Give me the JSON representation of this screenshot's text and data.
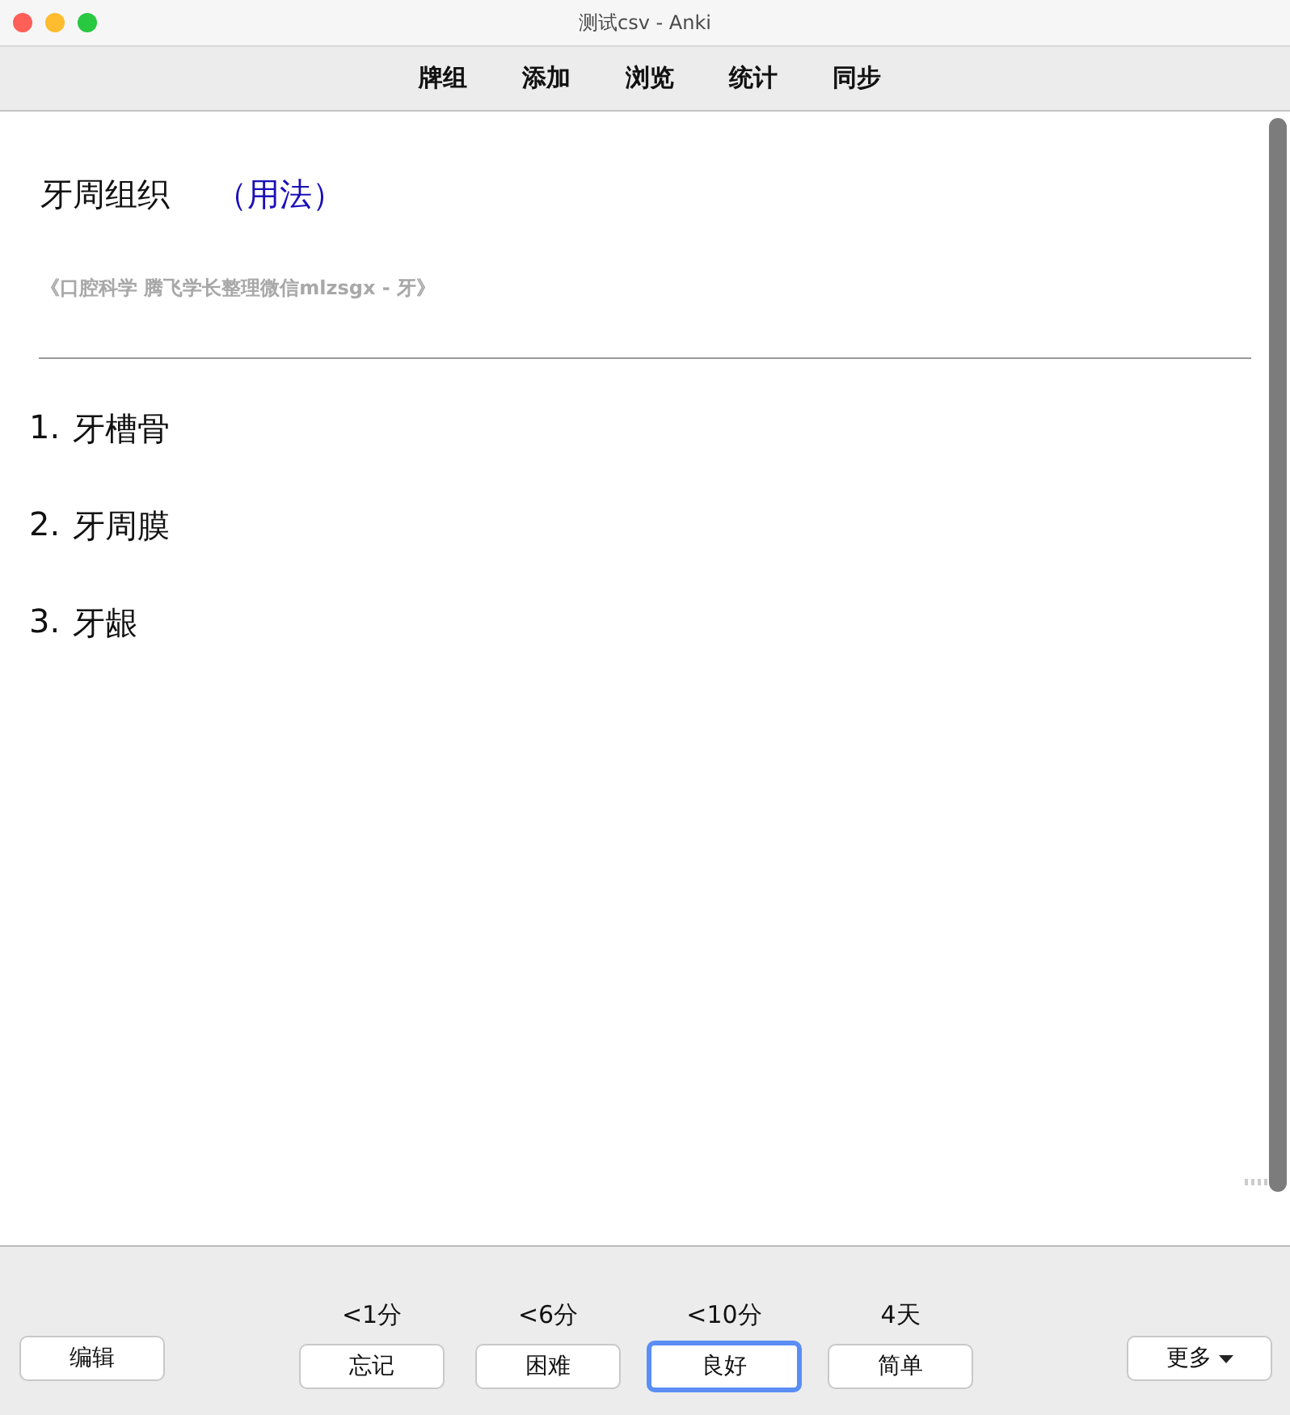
{
  "window": {
    "title": "测试csv - Anki"
  },
  "toolbar": [
    "牌组",
    "添加",
    "浏览",
    "统计",
    "同步"
  ],
  "card": {
    "question": "牙周组织",
    "hint": "（用法）",
    "source": "《口腔科学 腾飞学长整理微信mlzsgx - 牙》",
    "answers": [
      {
        "number": "1.",
        "text": "牙槽骨"
      },
      {
        "number": "2.",
        "text": "牙周膜"
      },
      {
        "number": "3.",
        "text": "牙龈"
      }
    ]
  },
  "bottom": {
    "edit": "编辑",
    "more": "更多",
    "answers": [
      {
        "interval": "<1分",
        "label": "忘记",
        "selected": false
      },
      {
        "interval": "<6分",
        "label": "困难",
        "selected": false
      },
      {
        "interval": "<10分",
        "label": "良好",
        "selected": true
      },
      {
        "interval": "4天",
        "label": "简单",
        "selected": false
      }
    ]
  }
}
